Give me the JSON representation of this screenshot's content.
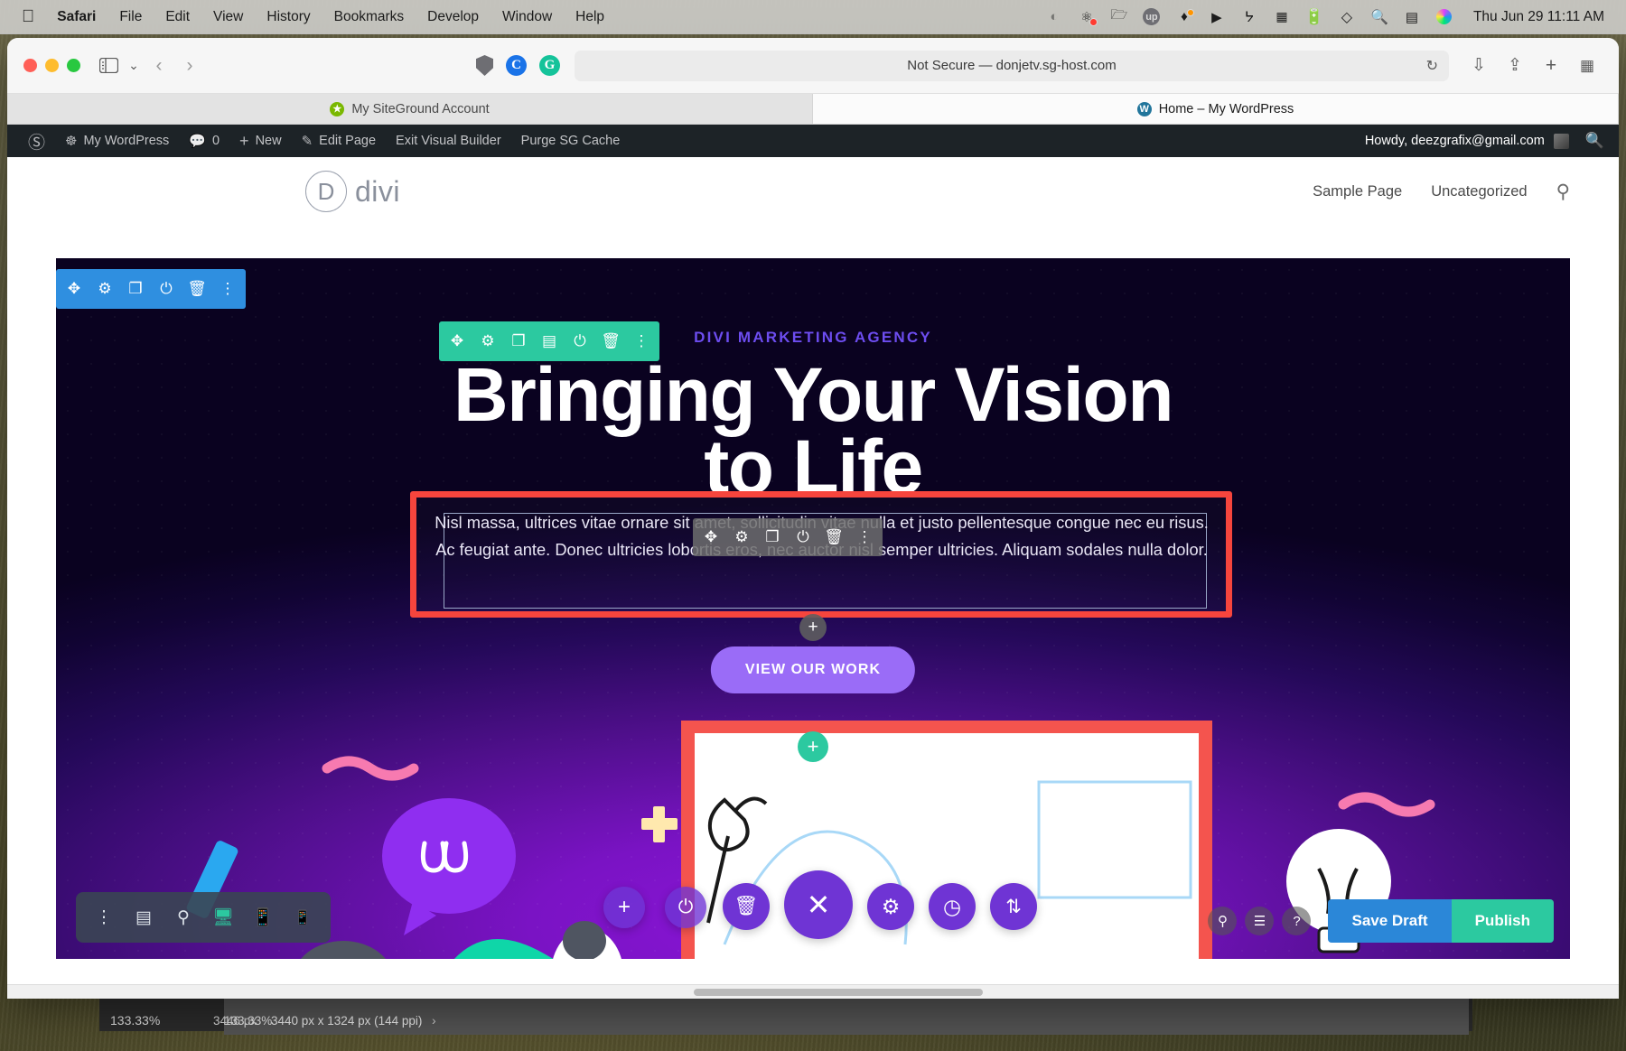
{
  "menubar": {
    "apple": "apple-logo",
    "items": [
      {
        "label": "Safari",
        "bold": true
      },
      {
        "label": "File",
        "bold": false
      },
      {
        "label": "Edit",
        "bold": false
      },
      {
        "label": "View",
        "bold": false
      },
      {
        "label": "History",
        "bold": false
      },
      {
        "label": "Bookmarks",
        "bold": false
      },
      {
        "label": "Develop",
        "bold": false
      },
      {
        "label": "Window",
        "bold": false
      },
      {
        "label": "Help",
        "bold": false
      }
    ],
    "status_icons": [
      "screen-recording-icon",
      "cleanmymac-icon",
      "folder-icon",
      "upwork-icon",
      "nordvpn-icon",
      "play-circle-icon",
      "bluetooth-icon",
      "calculator-icon",
      "battery-charging-icon",
      "wifi-icon",
      "search-icon",
      "control-center-icon",
      "siri-icon"
    ],
    "clock": "Thu Jun 29  11:11 AM"
  },
  "safari": {
    "window_controls": [
      "close",
      "minimize",
      "zoom"
    ],
    "sidebar_button": "sidebar-icon",
    "sidebar_chevron": "⌄",
    "back": "‹",
    "forward": "›",
    "extensions": [
      {
        "name": "shield-icon",
        "label": ""
      },
      {
        "name": "cookie-consent-icon",
        "label": "C",
        "color": "#1a73e8"
      },
      {
        "name": "grammarly-icon",
        "label": "G",
        "color": "#15c39a"
      }
    ],
    "url": "Not Secure — donjetv.sg-host.com",
    "reload_icon": "↻",
    "right_icons": [
      "downloads-icon",
      "share-icon",
      "new-tab-icon",
      "tab-overview-icon"
    ],
    "tabs": [
      {
        "label": "My SiteGround Account",
        "favicon": "siteground-icon",
        "favicon_color": "#7ab800",
        "active": false
      },
      {
        "label": "Home – My WordPress",
        "favicon": "wordpress-icon",
        "favicon_color": "#21759b",
        "active": true
      }
    ]
  },
  "wp_admin_bar": {
    "logo": "wordpress-logo-icon",
    "items": [
      {
        "label": "My WordPress",
        "icon": "dashboard-icon"
      },
      {
        "label": "0",
        "icon": "comment-bubble-icon"
      },
      {
        "label": "New",
        "icon": "plus-icon"
      },
      {
        "label": "Edit Page",
        "icon": "pencil-icon"
      },
      {
        "label": "Exit Visual Builder",
        "icon": ""
      },
      {
        "label": "Purge SG Cache",
        "icon": ""
      }
    ],
    "howdy": "Howdy, deezgrafix@gmail.com",
    "avatar": "avatar-icon",
    "search": "search-icon"
  },
  "site_header": {
    "logo_mark": "D",
    "logo_text": "divi",
    "nav": [
      {
        "label": "Sample Page"
      },
      {
        "label": "Uncategorized"
      }
    ],
    "search_icon": "search-icon"
  },
  "hero": {
    "eyebrow": "DIVI MARKETING AGENCY",
    "heading_line1": "Bringing Your Vision",
    "heading_line2": "to Life",
    "paragraph": "Nisl massa, ultrices vitae ornare sit amet, sollicitudin vitae nulla et justo pellentesque congue nec eu risus. Ac feugiat ante. Donec ultricies lobortis eros, nec auctor nisl semper ultricies. Aliquam sodales nulla dolor.",
    "cta_label": "VIEW OUR WORK",
    "colors": {
      "eyebrow": "#6d4df0",
      "cta_bg": "#9a6cf7",
      "highlight_border": "#f6453d",
      "section_toolbar": "#2f8fe0",
      "row_toolbar": "#2cc9a0",
      "module_toolbar": "#6d6d6d"
    }
  },
  "divi_toolbars": {
    "section": [
      "move-icon",
      "settings-gear-icon",
      "duplicate-icon",
      "columns-icon",
      "disable-icon",
      "trash-icon",
      "more-options-icon"
    ],
    "row": [
      "move-icon",
      "settings-gear-icon",
      "duplicate-icon",
      "columns-icon",
      "disable-icon",
      "trash-icon",
      "more-options-icon"
    ],
    "module": [
      "move-icon",
      "settings-gear-icon",
      "duplicate-icon",
      "disable-icon",
      "trash-icon",
      "more-options-icon"
    ]
  },
  "divi_bottom_bar": {
    "items": [
      {
        "name": "more-options-icon",
        "glyph": "⋮",
        "active": false
      },
      {
        "name": "wireframe-view-icon",
        "glyph": "⌸",
        "active": false
      },
      {
        "name": "zoom-out-view-icon",
        "glyph": "⚲",
        "active": false
      },
      {
        "name": "desktop-view-icon",
        "glyph": "▣",
        "active": true
      },
      {
        "name": "tablet-view-icon",
        "glyph": "□",
        "active": false
      },
      {
        "name": "phone-view-icon",
        "glyph": "▯",
        "active": false
      }
    ]
  },
  "divi_actions": {
    "right_circles": [
      {
        "name": "search-icon",
        "glyph": "⚲"
      },
      {
        "name": "layers-icon",
        "glyph": "≣"
      },
      {
        "name": "help-icon",
        "glyph": "?"
      }
    ],
    "save_draft": "Save Draft",
    "publish": "Publish"
  },
  "floating_buttons": [
    {
      "name": "add-module-button",
      "glyph": "+"
    },
    {
      "name": "disable-button",
      "glyph": "⏻"
    },
    {
      "name": "trash-button",
      "glyph": "🗑"
    },
    {
      "name": "close-button",
      "glyph": "✕"
    },
    {
      "name": "settings-button",
      "glyph": "⚙"
    },
    {
      "name": "history-button",
      "glyph": "◔"
    },
    {
      "name": "sort-button",
      "glyph": "⇅"
    }
  ],
  "status_strip": {
    "zoom_left": "133.33%",
    "dimension_left": "3446 px",
    "zoom_panel": "133.33%",
    "dimensions": "3440 px x 1324 px (144 ppi)",
    "chevron": "›"
  }
}
